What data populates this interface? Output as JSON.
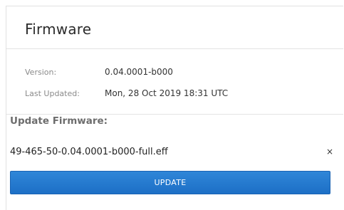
{
  "panel": {
    "title": "Firmware"
  },
  "info": {
    "version_label": "Version:",
    "version_value": "0.04.0001-b000",
    "updated_label": "Last Updated:",
    "updated_value": "Mon, 28 Oct 2019 18:31 UTC"
  },
  "update": {
    "section_title": "Update Firmware:",
    "file_name": "49-465-50-0.04.0001-b000-full.eff",
    "remove_glyph": "×",
    "button_label": "UPDATE"
  },
  "colors": {
    "button_blue": "#1d6fc6",
    "label_gray": "#8a8a8a"
  }
}
